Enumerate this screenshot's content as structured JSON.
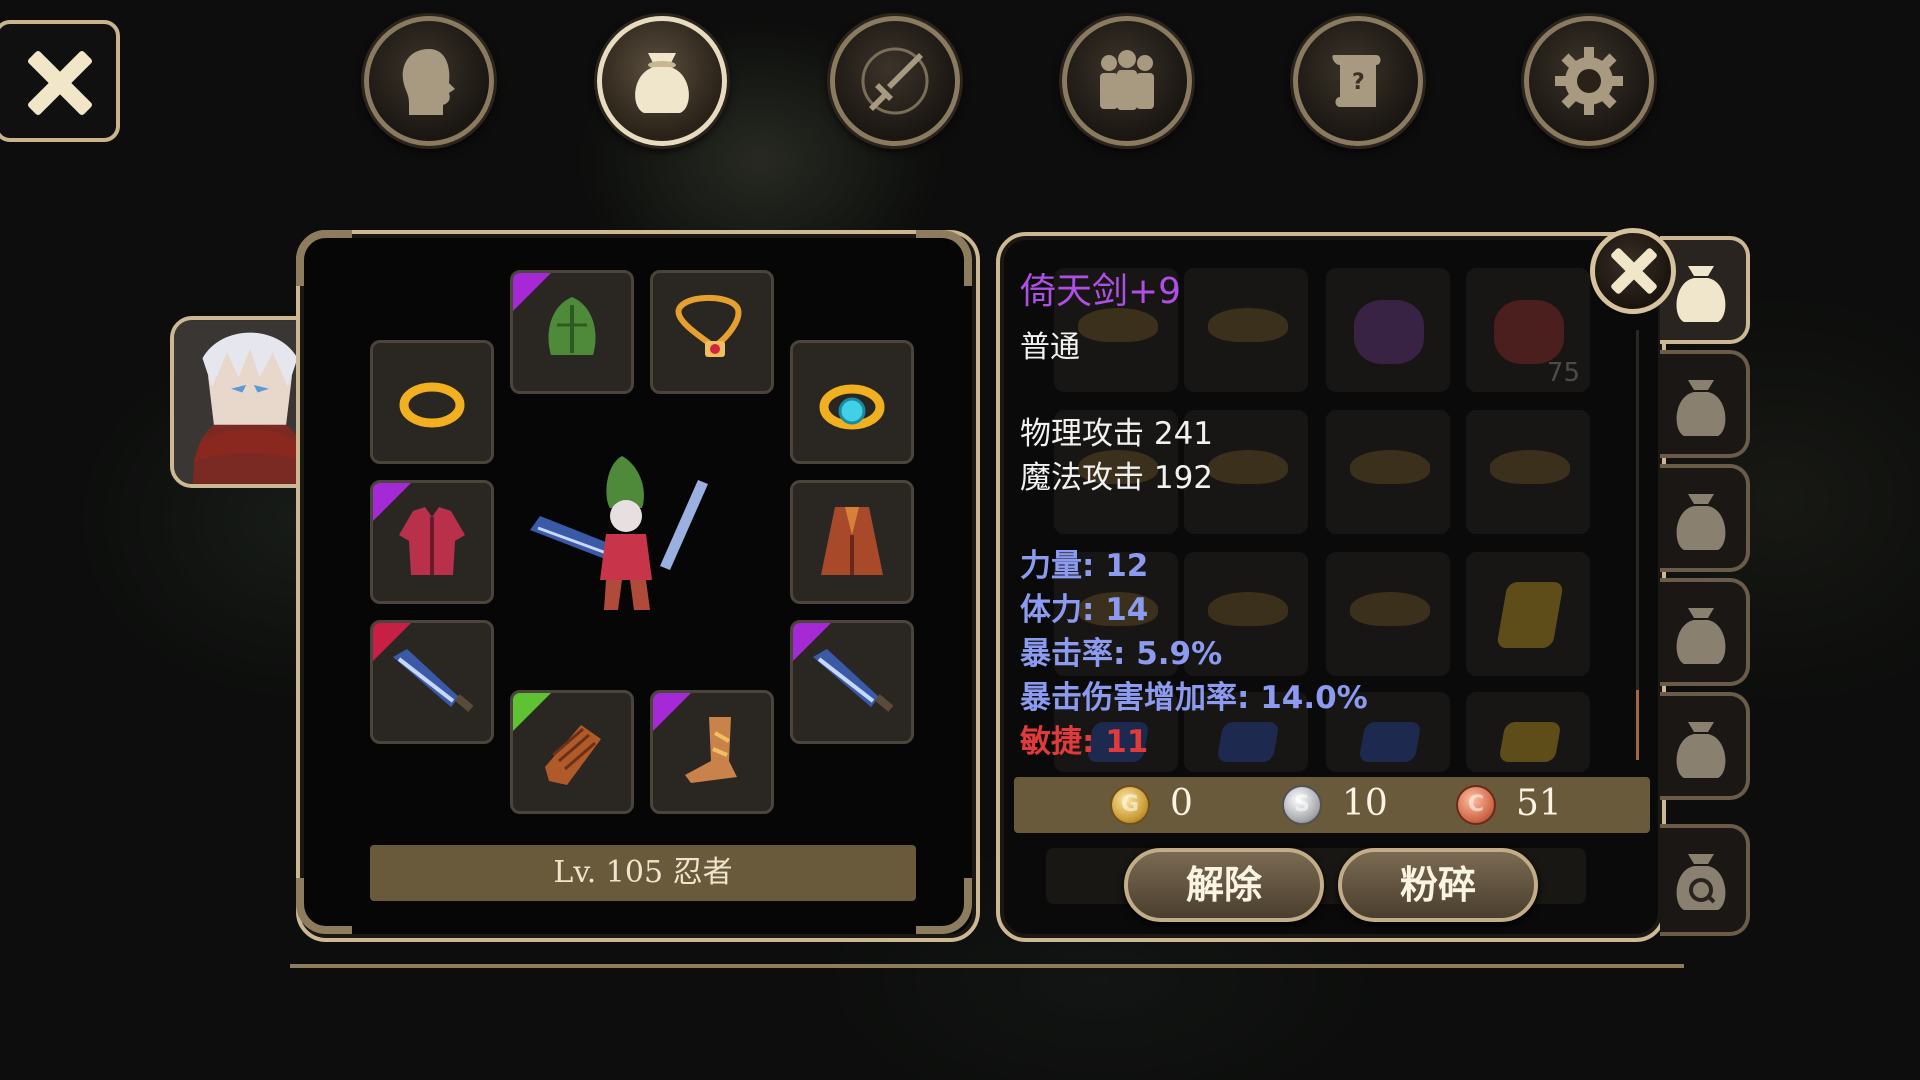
{
  "tabs": [
    {
      "name": "character",
      "icon": "head-icon",
      "active": false
    },
    {
      "name": "inventory",
      "icon": "bag-icon",
      "active": true
    },
    {
      "name": "skills",
      "icon": "sword-icon",
      "active": false
    },
    {
      "name": "party",
      "icon": "people-icon",
      "active": false
    },
    {
      "name": "quests",
      "icon": "scroll-icon",
      "active": false
    },
    {
      "name": "settings",
      "icon": "gear-icon",
      "active": false
    }
  ],
  "character": {
    "level_label": "Lv. 105 忍者"
  },
  "item": {
    "name": "倚天剑+9",
    "grade": "普通",
    "stats": [
      "物理攻击 241",
      "魔法攻击 192"
    ],
    "bonuses": [
      "力量: 12",
      "体力: 14",
      "暴击率: 5.9%",
      "暴击伤害增加率: 14.0%"
    ],
    "penalty": "敏捷: 11",
    "colors": {
      "name": "#b04fe8",
      "bonus": "#8c9bf0",
      "penalty": "#e13a3a"
    }
  },
  "inventory_ghost": {
    "stack_count": "75"
  },
  "currency": {
    "gold": {
      "icon_letter": "G",
      "value": "0"
    },
    "silver": {
      "icon_letter": "S",
      "value": "10"
    },
    "copper": {
      "icon_letter": "C",
      "value": "51"
    }
  },
  "buttons": {
    "unequip": "解除",
    "smash": "粉碎"
  },
  "bag_tabs": [
    {
      "icon": "bag-icon",
      "active": true
    },
    {
      "icon": "bag-icon",
      "active": false
    },
    {
      "icon": "bag-icon",
      "active": false
    },
    {
      "icon": "bag-icon",
      "active": false
    },
    {
      "icon": "bag-icon",
      "active": false
    },
    {
      "icon": "bag-search-icon",
      "active": false
    }
  ]
}
